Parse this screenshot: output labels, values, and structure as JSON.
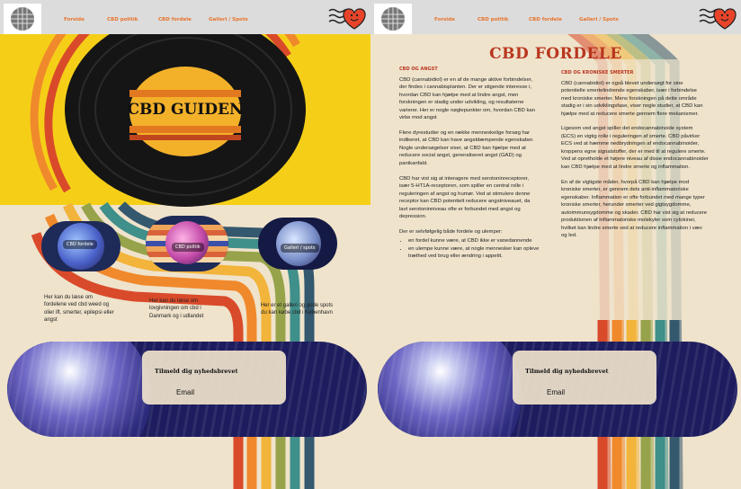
{
  "nav": {
    "items": [
      "Forside",
      "CBD politik",
      "CBD fordele",
      "Galleri / Spots"
    ]
  },
  "home": {
    "hero_title": "CBD GUIDEN",
    "bubbles": [
      {
        "label": "CBD fordele",
        "caption": "Her kan du læse om fordelene ved cbd weed og olier ift. smerter, epilepsi eller angst"
      },
      {
        "label": "CBD politik",
        "caption": "Her kan du læse om lovgivningen om cbd i Danmark og i udlandet"
      },
      {
        "label": "Galleri / spots",
        "caption": "Her er et galleri og gode spots du kan købe cbd i København"
      }
    ]
  },
  "newsletter": {
    "title": "Tilmeld dig nyhedsbrevet",
    "email_label": "Email"
  },
  "article": {
    "title": "CBD FORDELE",
    "angst_heading": "CBD OG ANGST",
    "angst_paragraphs": [
      "CBD (cannabidiol) er en af de mange aktive forbindelser, der findes i cannabisplanten. Der er stigende interesse i, hvordan CBD kan hjælpe med at lindre angst, men forskningen er stadig under udvikling, og resultaterne varierer. Her er nogle nøglepunkter om, hvordan CBD kan virke mod angst",
      "Flere dyrestudier og en række menneskelige forsøg har indikeret, at CBD kan have angstdæmpende egenskaber. Nogle undersøgelser viser, at CBD kan hjælpe med at reducere social angst, generaliseret angst (GAD) og panikanfald.",
      "CBD har vist sig at interagere med serotoninreceptorer, især 5-HT1A-receptoren, som spiller en central rolle i reguleringen af angst og humør. Ved at stimulere denne receptor kan CBD potentielt reducere angstniveauet, da lavt serotoninniveau ofte er forbundet med angst og depression.",
      "Der er selvfølgelig både fordele og ulemper:"
    ],
    "bullets": [
      "en fordel kunne være, at CBD ikke er vanedannende",
      "en ulempe kunne være, at nogle mennesker kan opleve træthed ved brug eller ændring i appetit."
    ],
    "smerter_heading": "CBD OG KRONISKE SMERTER",
    "smerter_paragraphs": [
      "CBD (cannabidiol) er også blevet undersøgt for sine potentielle smertelindrende egenskaber, især i forbindelse med kroniske smerter. Mens forskningen på dette område stadig er i sin udviklingsfase, viser nogle studier, at CBD kan hjælpe med at reducere smerte gennem flere mekanismer.",
      "Ligesom ved angst spiller det endocannabinoide system (ECS) en vigtig rolle i reguleringen af smerte. CBD påvirker ECS ved at hæmme nedbrydningen af endocannabinoider, kroppens egne signalstoffer, der er med til at regulere smerte. Ved at opretholde et højere niveau af disse endocannabinoider kan CBD hjælpe med at lindre smerte og inflammation.",
      "En af de vigtigste måder, hvorpå CBD kan hjælpe mod kroniske smerter, er gennem dets anti-inflammatoriske egenskaber. Inflammation er ofte forbundet med mange typer kroniske smerter, herunder smerter ved gigtsygdomme, autoimmunsygdomme og skader. CBD har vist sig at reducere produktionen af inflammatoriske molekyler som cytokiner, hvilket kan lindre smerte ved at reducere inflammation i væv og led."
    ]
  },
  "colors": {
    "accent": "#e8732c",
    "title_red": "#b9361e",
    "hero_yellow": "#f5cf17",
    "background": "#efe3cc",
    "newsletter_navy": "#1d1c5e"
  },
  "icons": [
    "disco-ball-logo-icon",
    "smiley-heart-stamp-icon",
    "vinyl-record-icon",
    "disco-ball-icon"
  ]
}
